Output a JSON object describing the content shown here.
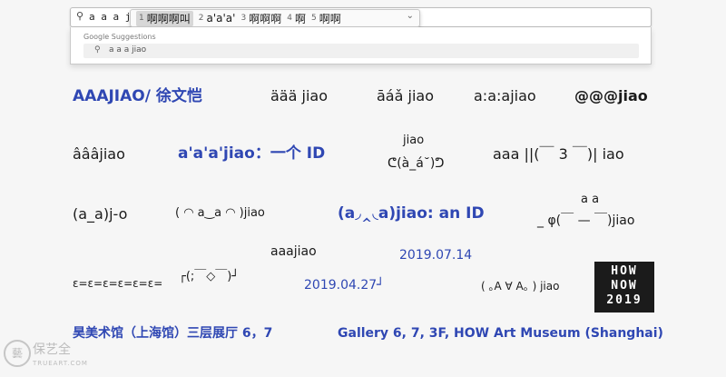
{
  "search": {
    "query": "a a a jiao"
  },
  "ime": {
    "candidates": [
      {
        "num": "1",
        "text": "啊啊啊叫"
      },
      {
        "num": "2",
        "text": "a'a'a'"
      },
      {
        "num": "3",
        "text": "啊啊啊"
      },
      {
        "num": "4",
        "text": "啊"
      },
      {
        "num": "5",
        "text": "啊啊"
      }
    ],
    "selected_index": 0
  },
  "suggestions": {
    "header": "Google Suggestions",
    "items": [
      "a a a jiao"
    ]
  },
  "content": {
    "title_cn": "AAAJIAO/ 徐文恺",
    "v_umlaut": "äää jiao",
    "v_accent": "āáǎ jiao",
    "v_colon": "a:a:ajiao",
    "v_at": "@@@jiao",
    "v_circ": "âââjiao",
    "id_cn": "a'a'a'jiao：一个 ID",
    "face1_top": "jiao",
    "face1": "ᕦ(à_á˘)ᕤ",
    "face2": "aaa ||(￣ 3 ￣)| iao",
    "aj": "(a_a)j-o",
    "face3": "( ◠ a‿a ◠ )jiao",
    "an_id": "(a◞‸◟a)jiao: an ID",
    "face4_top": "a    a",
    "face4": "_ φ(￣ — ￣)jiao",
    "aaa_small": "aaajiao",
    "date1": "2019.07.14",
    "eps": "ε=ε=ε=ε=ε=ε=",
    "face5": "┌(;￣◇￣)┘",
    "date2": "2019.04.27┘",
    "face6": "( ｡A ∀ A｡ ) jiao",
    "venue_cn": "昊美术馆（上海馆）三层展厅 6，7",
    "venue_en": "Gallery 6, 7, 3F, HOW Art Museum (Shanghai)"
  },
  "logo": {
    "line1": "HOW",
    "line2": "NOW",
    "line3": "2019"
  },
  "watermark": {
    "cn": "保艺全",
    "en": "TRUEART.COM"
  }
}
